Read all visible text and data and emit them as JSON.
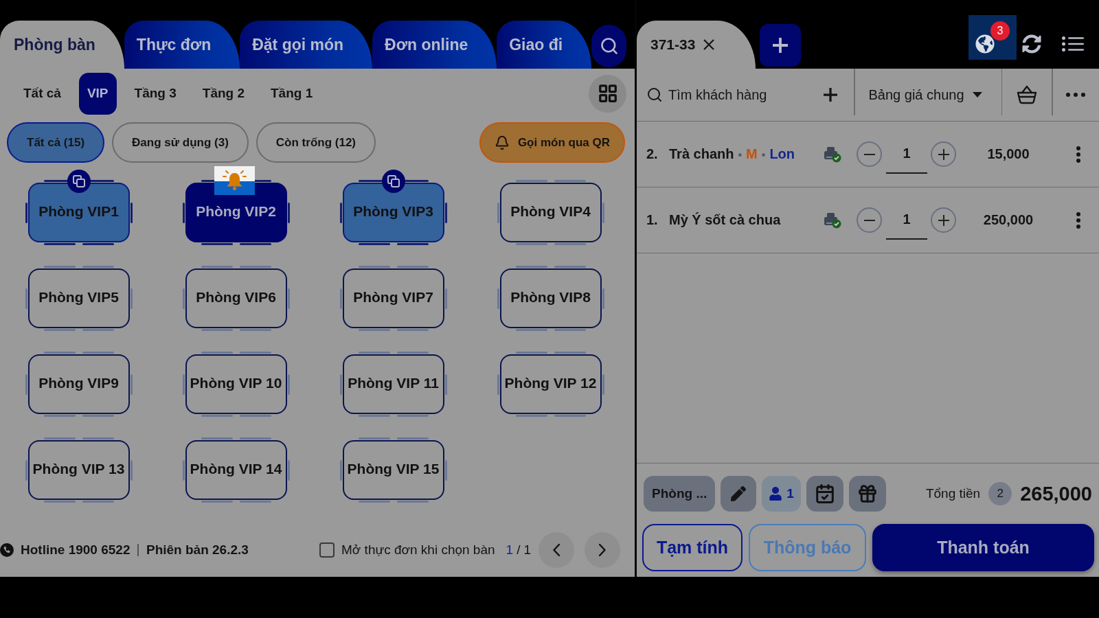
{
  "left_tabs": [
    {
      "label": "Phòng bàn",
      "selected": true
    },
    {
      "label": "Thực đơn",
      "selected": false
    },
    {
      "label": "Đặt gọi món",
      "selected": false
    },
    {
      "label": "Đơn online",
      "selected": false
    },
    {
      "label": "Giao đi",
      "selected": false
    }
  ],
  "floors": [
    {
      "label": "Tất cả",
      "selected": false
    },
    {
      "label": "VIP",
      "selected": true
    },
    {
      "label": "Tầng 3",
      "selected": false
    },
    {
      "label": "Tầng 2",
      "selected": false
    },
    {
      "label": "Tầng 1",
      "selected": false
    }
  ],
  "room_filters": [
    {
      "label": "Tất cả (15)",
      "selected": true
    },
    {
      "label": "Đang sử dụng (3)",
      "selected": false
    },
    {
      "label": "Còn trống (12)",
      "selected": false
    }
  ],
  "qr_order_button": {
    "label": "Gọi món qua QR"
  },
  "rooms": [
    {
      "name": "Phòng VIP1",
      "occupied": true,
      "selected": false,
      "linked": true,
      "alert": false
    },
    {
      "name": "Phòng VIP2",
      "occupied": true,
      "selected": true,
      "linked": false,
      "alert": true
    },
    {
      "name": "Phòng VIP3",
      "occupied": true,
      "selected": false,
      "linked": true,
      "alert": false
    },
    {
      "name": "Phòng VIP4",
      "occupied": false,
      "selected": false,
      "linked": false,
      "alert": false
    },
    {
      "name": "Phòng VIP5",
      "occupied": false,
      "selected": false,
      "linked": false,
      "alert": false
    },
    {
      "name": "Phòng VIP6",
      "occupied": false,
      "selected": false,
      "linked": false,
      "alert": false
    },
    {
      "name": "Phòng VIP7",
      "occupied": false,
      "selected": false,
      "linked": false,
      "alert": false
    },
    {
      "name": "Phòng VIP8",
      "occupied": false,
      "selected": false,
      "linked": false,
      "alert": false
    },
    {
      "name": "Phòng VIP9",
      "occupied": false,
      "selected": false,
      "linked": false,
      "alert": false
    },
    {
      "name": "Phòng VIP 10",
      "occupied": false,
      "selected": false,
      "linked": false,
      "alert": false
    },
    {
      "name": "Phòng VIP 11",
      "occupied": false,
      "selected": false,
      "linked": false,
      "alert": false
    },
    {
      "name": "Phòng VIP 12",
      "occupied": false,
      "selected": false,
      "linked": false,
      "alert": false
    },
    {
      "name": "Phòng VIP 13",
      "occupied": false,
      "selected": false,
      "linked": false,
      "alert": false
    },
    {
      "name": "Phòng VIP 14",
      "occupied": false,
      "selected": false,
      "linked": false,
      "alert": false
    },
    {
      "name": "Phòng VIP 15",
      "occupied": false,
      "selected": false,
      "linked": false,
      "alert": false
    }
  ],
  "footer": {
    "hotline": "Hotline 1900 6522",
    "version": "Phiên bản 26.2.3",
    "open_menu_option": {
      "label": "Mở thực đơn khi chọn bàn",
      "checked": false
    },
    "page": {
      "current": "1",
      "separator": "/",
      "total": "1"
    }
  },
  "order_tabs": [
    {
      "label": "371-33",
      "selected": true
    }
  ],
  "notifications": {
    "count": "3"
  },
  "customer_search": {
    "placeholder": "Tìm khách hàng"
  },
  "price_list": {
    "value": "Bảng giá chung"
  },
  "order_items": [
    {
      "index": "2.",
      "name": "Trà chanh",
      "options": [
        {
          "bullet": "•",
          "text": "M",
          "color": "#c4520c"
        },
        {
          "bullet": "•",
          "text": "Lon",
          "color": "#15268e"
        }
      ],
      "sent": true,
      "quantity": "1",
      "price": "15,000"
    },
    {
      "index": "1.",
      "name": "Mỳ Ý sốt cà chua",
      "sent": true,
      "quantity": "1",
      "price": "250,000"
    }
  ],
  "order_info": {
    "room": "Phòng ...",
    "guests": "1"
  },
  "total": {
    "label": "Tổng tiền",
    "item_count": "2",
    "amount": "265,000"
  },
  "actions": [
    {
      "label": "Tạm tính",
      "kind": "temporary"
    },
    {
      "label": "Thông báo",
      "kind": "notify"
    },
    {
      "label": "Thanh toán",
      "kind": "payment"
    }
  ]
}
